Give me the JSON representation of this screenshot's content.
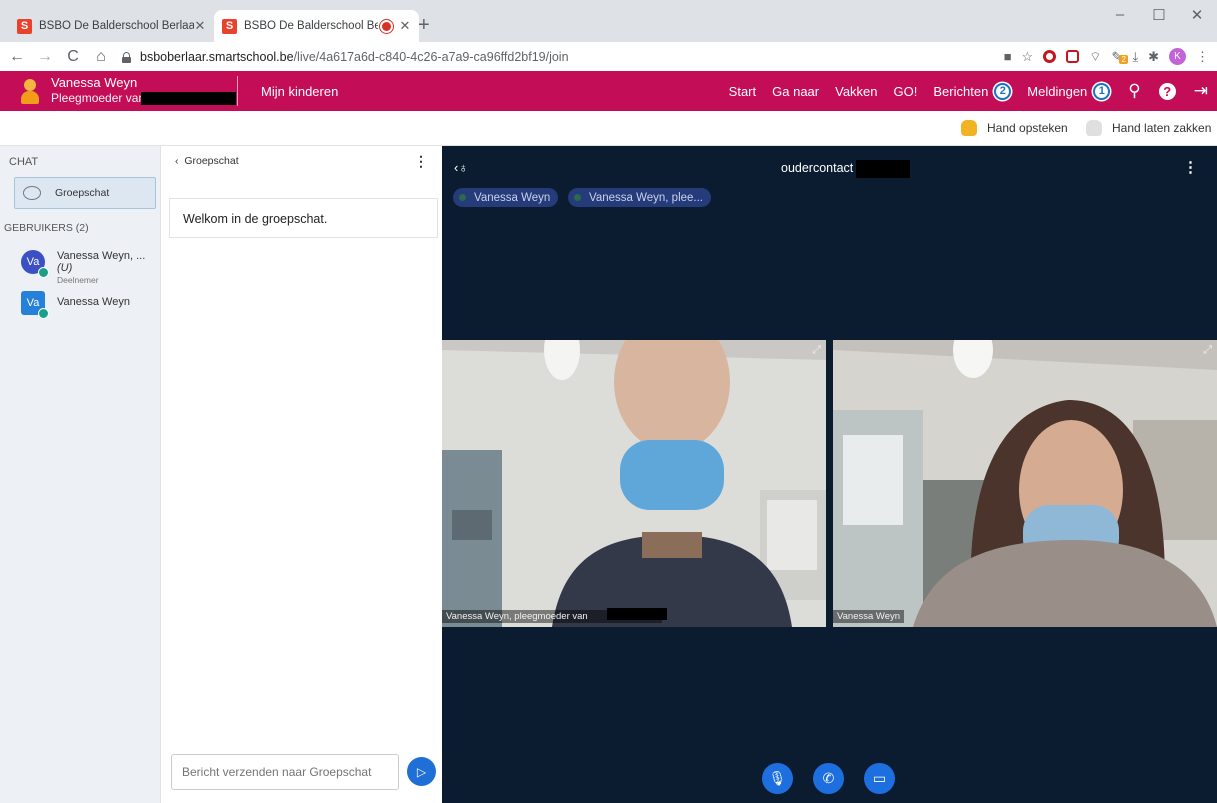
{
  "browser": {
    "tabs": [
      {
        "title": "BSBO De Balderschool Berlaar - S",
        "favicon": "S"
      },
      {
        "title": "BSBO De Balderschool Berlaa",
        "favicon": "S"
      }
    ],
    "url_host": "bsboberlaar.smartschool.be",
    "url_path": "/live/4a617a6d-c840-4c26-a7a9-ca96ffd2bf19/join",
    "profile_initial": "K",
    "ext_badge": "2"
  },
  "header": {
    "user_name": "Vanessa Weyn",
    "user_subtitle": "Pleegmoeder van",
    "kids_label": "Mijn kinderen",
    "nav": {
      "start": "Start",
      "ganaar": "Ga naar",
      "vakken": "Vakken",
      "go": "GO!",
      "berichten": "Berichten",
      "berichten_count": "2",
      "meldingen": "Meldingen",
      "meldingen_count": "1"
    },
    "brand_color": "#c30d56"
  },
  "handbar": {
    "raise": "Hand opsteken",
    "lower": "Hand laten zakken"
  },
  "sidebar": {
    "chat_label": "CHAT",
    "group_button": "Groepschat",
    "users_label": "GEBRUIKERS (2)",
    "users": [
      {
        "initials": "Va",
        "name": "Vanessa Weyn, ...",
        "you": "(U)",
        "role": "Deelnemer"
      },
      {
        "initials": "Va",
        "name": "Vanessa Weyn",
        "you": "",
        "role": ""
      }
    ]
  },
  "chat": {
    "header": "Groepschat",
    "welcome": "Welkom in de groepschat.",
    "input_placeholder": "Bericht verzenden naar Groepschat"
  },
  "video": {
    "title": "oudercontact",
    "chips": [
      "Vanessa Weyn",
      "Vanessa Weyn, plee..."
    ],
    "tiles": [
      {
        "label": "Vanessa Weyn, pleegmoeder van"
      },
      {
        "label": "Vanessa Weyn"
      }
    ],
    "background": "#0b1c30",
    "control_color": "#1d6fe0"
  }
}
